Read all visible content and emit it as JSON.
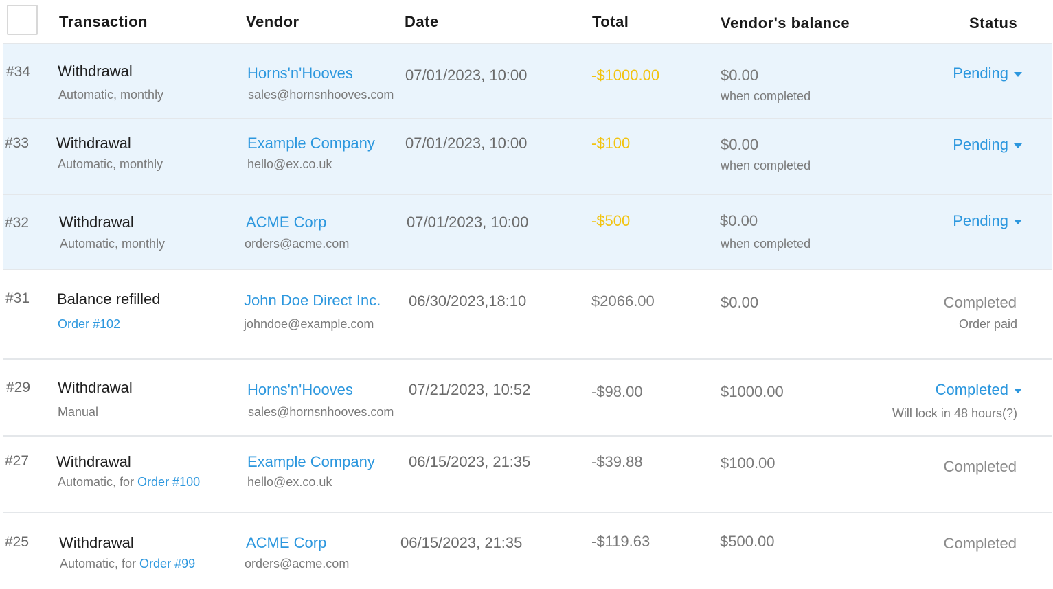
{
  "header": {
    "transaction": "Transaction",
    "vendor": "Vendor",
    "date": "Date",
    "total": "Total",
    "balance": "Vendor's balance",
    "status": "Status"
  },
  "colors": {
    "link": "#2c97de",
    "pending_total": "#f2c30f",
    "pending_row_bg": "#eaf4fc"
  },
  "rows": [
    {
      "id": "#34",
      "type": "Withdrawal",
      "sub": "Automatic, monthly",
      "vendor": "Horns'n'Hooves",
      "email": "sales@hornsnhooves.com",
      "date": "07/01/2023, 10:00",
      "total": "-$1000.00",
      "balance": "$0.00",
      "balance_note": "when completed",
      "status": "Pending"
    },
    {
      "id": "#33",
      "type": "Withdrawal",
      "sub": "Automatic, monthly",
      "vendor": "Example Company",
      "email": "hello@ex.co.uk",
      "date": "07/01/2023, 10:00",
      "total": "-$100",
      "balance": "$0.00",
      "balance_note": "when completed",
      "status": "Pending"
    },
    {
      "id": "#32",
      "type": "Withdrawal",
      "sub": "Automatic, monthly",
      "vendor": "ACME Corp",
      "email": "orders@acme.com",
      "date": "07/01/2023, 10:00",
      "total": "-$500",
      "balance": "$0.00",
      "balance_note": "when completed",
      "status": "Pending"
    },
    {
      "id": "#31",
      "type": "Balance refilled",
      "sub_link": "Order #102",
      "vendor": "John Doe Direct Inc.",
      "email": "johndoe@example.com",
      "date": "06/30/2023,18:10",
      "total": "$2066.00",
      "balance": "$0.00",
      "status": "Completed",
      "status_note": "Order paid"
    },
    {
      "id": "#29",
      "type": "Withdrawal",
      "sub": "Manual",
      "vendor": "Horns'n'Hooves",
      "email": "sales@hornsnhooves.com",
      "date": "07/21/2023, 10:52",
      "total": "-$98.00",
      "balance": "$1000.00",
      "status": "Completed",
      "status_note": "Will lock in 48 hours(?)"
    },
    {
      "id": "#27",
      "type": "Withdrawal",
      "sub": "Automatic, for ",
      "sub_link": "Order #100",
      "vendor": "Example Company",
      "email": "hello@ex.co.uk",
      "date": "06/15/2023, 21:35",
      "total": "-$39.88",
      "balance": "$100.00",
      "status": "Completed"
    },
    {
      "id": "#25",
      "type": "Withdrawal",
      "sub": "Automatic, for ",
      "sub_link": "Order #99",
      "vendor": "ACME Corp",
      "email": "orders@acme.com",
      "date": "06/15/2023, 21:35",
      "total": "-$119.63",
      "balance": "$500.00",
      "status": "Completed"
    }
  ]
}
